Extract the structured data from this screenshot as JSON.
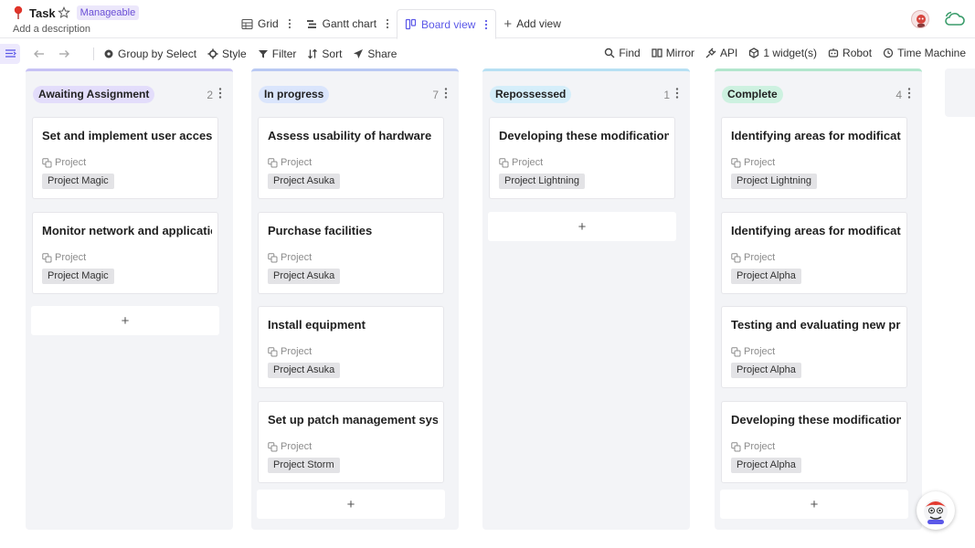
{
  "header": {
    "title": "Task",
    "badge": "Manageable",
    "description": "Add a description",
    "views": [
      {
        "label": "Grid",
        "icon": "grid-icon"
      },
      {
        "label": "Gantt chart",
        "icon": "gantt-icon"
      },
      {
        "label": "Board view",
        "icon": "board-icon",
        "active": true
      }
    ],
    "add_view": "Add view"
  },
  "toolbar": {
    "left": [
      {
        "label": "Group by Select",
        "icon": "group-icon"
      },
      {
        "label": "Style",
        "icon": "style-icon"
      },
      {
        "label": "Filter",
        "icon": "filter-icon"
      },
      {
        "label": "Sort",
        "icon": "sort-icon"
      },
      {
        "label": "Share",
        "icon": "share-icon"
      }
    ],
    "right": [
      {
        "label": "Find",
        "icon": "search-icon"
      },
      {
        "label": "Mirror",
        "icon": "mirror-icon"
      },
      {
        "label": "API",
        "icon": "api-icon"
      },
      {
        "label": "1 widget(s)",
        "icon": "widget-icon"
      },
      {
        "label": "Robot",
        "icon": "robot-icon"
      },
      {
        "label": "Time Machine",
        "icon": "history-icon"
      }
    ]
  },
  "columns": [
    {
      "status": "Awaiting Assignment",
      "count": "2",
      "color": "#e3ddfb",
      "bar": "#c7c2f5",
      "cards": [
        {
          "title": "Set and implement user access",
          "label": "Project",
          "tag": "Project Magic"
        },
        {
          "title": "Monitor network and applications",
          "label": "Project",
          "tag": "Project Magic"
        }
      ]
    },
    {
      "status": "In progress",
      "count": "7",
      "color": "#dae5fc",
      "bar": "#b9c9f3",
      "cards": [
        {
          "title": "Assess usability of hardware",
          "label": "Project",
          "tag": "Project Asuka"
        },
        {
          "title": "Purchase facilities",
          "label": "Project",
          "tag": "Project Asuka"
        },
        {
          "title": "Install equipment",
          "label": "Project",
          "tag": "Project Asuka"
        },
        {
          "title": "Set up patch management system",
          "label": "Project",
          "tag": "Project Storm"
        }
      ]
    },
    {
      "status": "Repossessed",
      "count": "1",
      "color": "#d5eefa",
      "bar": "#b7e0f3",
      "cards": [
        {
          "title": "Developing these modifications",
          "label": "Project",
          "tag": "Project Lightning"
        }
      ]
    },
    {
      "status": "Complete",
      "count": "4",
      "color": "#cdf1e0",
      "bar": "#b2e6cd",
      "cards": [
        {
          "title": "Identifying areas for modification",
          "label": "Project",
          "tag": "Project Lightning"
        },
        {
          "title": "Identifying areas for modification",
          "label": "Project",
          "tag": "Project Alpha"
        },
        {
          "title": "Testing and evaluating new product",
          "label": "Project",
          "tag": "Project Alpha"
        },
        {
          "title": "Developing these modifications",
          "label": "Project",
          "tag": "Project Alpha"
        }
      ]
    }
  ]
}
